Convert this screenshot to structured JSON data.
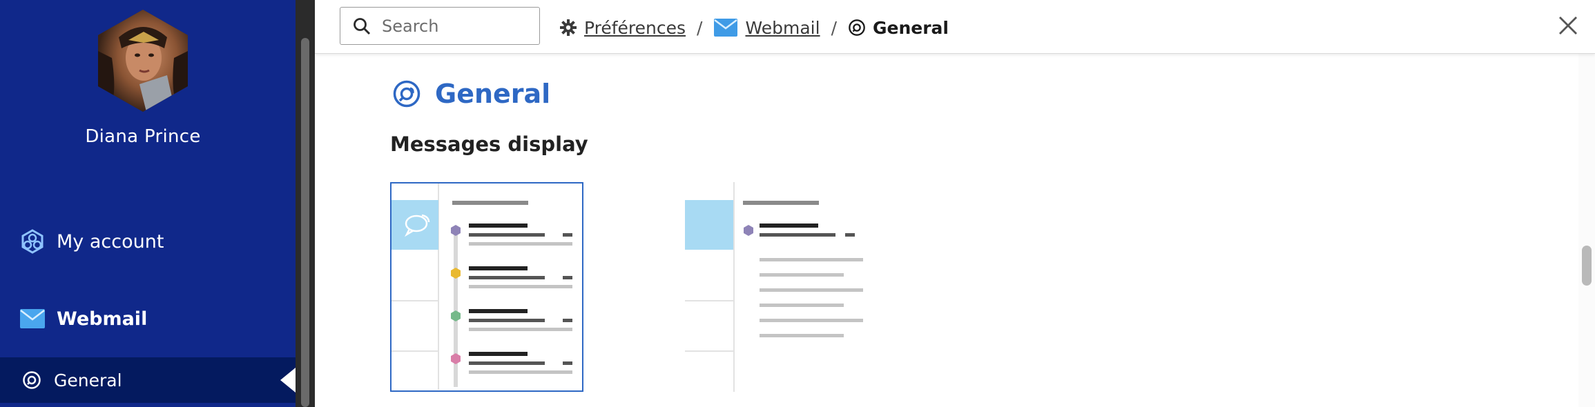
{
  "sidebar": {
    "user_name": "Diana Prince",
    "items": [
      {
        "label": "My account",
        "icon": "account-icon"
      },
      {
        "label": "Webmail",
        "icon": "mail-icon"
      },
      {
        "label": "General",
        "icon": "general-icon",
        "active": true
      }
    ]
  },
  "search": {
    "placeholder": "Search",
    "value": ""
  },
  "breadcrumb": {
    "preferences": "Préférences",
    "webmail": "Webmail",
    "current": "General",
    "separator": "/"
  },
  "main": {
    "title": "General",
    "section_title": "Messages display",
    "options": [
      {
        "name": "conversation-view",
        "selected": true
      },
      {
        "name": "message-preview-view",
        "selected": false
      }
    ]
  },
  "colors": {
    "sidebar_bg": "#10288a",
    "sidebar_active_bg": "#041a5f",
    "accent": "#2e68c4",
    "preview_highlight": "#a8daf3"
  }
}
